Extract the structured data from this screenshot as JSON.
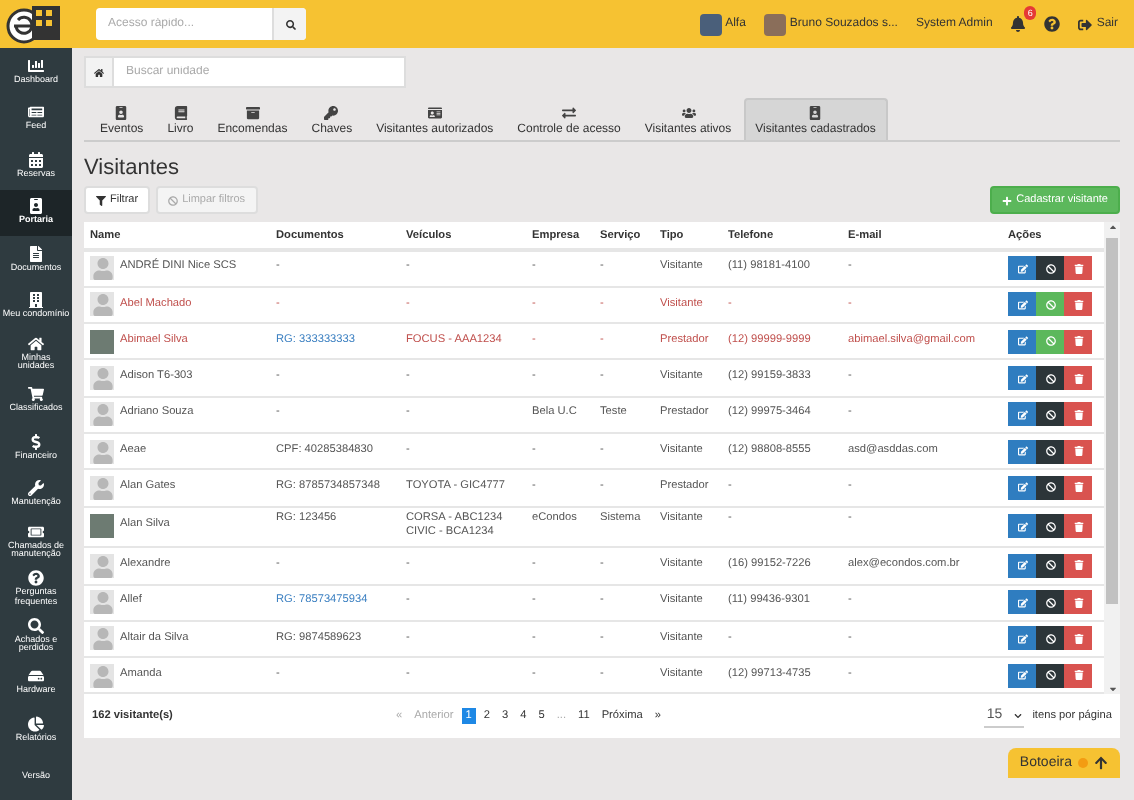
{
  "topbar": {
    "search": {
      "placeholder": "Acesso rápido..."
    },
    "condo": "Alfa",
    "user": "Bruno Souzados s...",
    "role": "System Admin",
    "notifications": "6",
    "logout": "Sair"
  },
  "sidebar": {
    "items": [
      {
        "label": "Dashboard",
        "selected": false
      },
      {
        "label": "Feed",
        "selected": false
      },
      {
        "label": "Reservas",
        "selected": false
      },
      {
        "label": "Portaria",
        "selected": true
      },
      {
        "label": "Documentos",
        "selected": false
      },
      {
        "label": "Meu condomínio",
        "selected": false
      },
      {
        "label": "Minhas unidades",
        "selected": false
      },
      {
        "label": "Classificados",
        "selected": false
      },
      {
        "label": "Financeiro",
        "selected": false
      },
      {
        "label": "Manutenção",
        "selected": false
      },
      {
        "label": "Chamados de manutenção",
        "selected": false
      },
      {
        "label": "Perguntas frequentes",
        "selected": false
      },
      {
        "label": "Achados e perdidos",
        "selected": false
      },
      {
        "label": "Hardware",
        "selected": false
      },
      {
        "label": "Relatórios",
        "selected": false
      },
      {
        "label": "Versão",
        "selected": false
      }
    ]
  },
  "unit_search": {
    "placeholder": "Buscar unidade"
  },
  "tabs": [
    {
      "label": "Eventos",
      "selected": false
    },
    {
      "label": "Livro",
      "selected": false
    },
    {
      "label": "Encomendas",
      "selected": false
    },
    {
      "label": "Chaves",
      "selected": false
    },
    {
      "label": "Visitantes autorizados",
      "selected": false
    },
    {
      "label": "Controle de acesso",
      "selected": false
    },
    {
      "label": "Visitantes ativos",
      "selected": false
    },
    {
      "label": "Visitantes cadastrados",
      "selected": true
    }
  ],
  "page": {
    "title": "Visitantes",
    "filter_button": "Filtrar",
    "clear_button": "Limpar filtros",
    "add_button": "Cadastrar visitante"
  },
  "table": {
    "columns": [
      "Name",
      "Documentos",
      "Veículos",
      "Empresa",
      "Serviço",
      "Tipo",
      "Telefone",
      "E-mail",
      "Ações"
    ],
    "rows": [
      {
        "has_photo": false,
        "name": "ANDRÉ DINI Nice SCS",
        "document": {
          "text": "-",
          "link": false
        },
        "vehicles": [
          "-"
        ],
        "company": "-",
        "service": "-",
        "type": "Visitante",
        "phone": "(11) 98181-4100",
        "email": "-",
        "blocked": false
      },
      {
        "has_photo": false,
        "name": "Abel Machado",
        "document": {
          "text": "-",
          "link": false
        },
        "vehicles": [
          "-"
        ],
        "company": "-",
        "service": "-",
        "type": "Visitante",
        "phone": "-",
        "email": "-",
        "blocked": true
      },
      {
        "has_photo": true,
        "name": "Abimael Silva",
        "document": {
          "text": "RG: 333333333",
          "link": true
        },
        "vehicles": [
          "FOCUS - AAA1234"
        ],
        "company": "-",
        "service": "-",
        "type": "Prestador",
        "phone": "(12) 99999-9999",
        "email": "abimael.silva@gmail.com",
        "blocked": true
      },
      {
        "has_photo": false,
        "name": "Adison T6-303",
        "document": {
          "text": "-",
          "link": false
        },
        "vehicles": [
          "-"
        ],
        "company": "-",
        "service": "-",
        "type": "Visitante",
        "phone": "(12) 99159-3833",
        "email": "-",
        "blocked": false
      },
      {
        "has_photo": false,
        "name": "Adriano Souza",
        "document": {
          "text": "-",
          "link": false
        },
        "vehicles": [
          "-"
        ],
        "company": "Bela U.C",
        "service": "Teste",
        "type": "Prestador",
        "phone": "(12) 99975-3464",
        "email": "-",
        "blocked": false
      },
      {
        "has_photo": false,
        "name": "Aeae",
        "document": {
          "text": "CPF: 40285384830",
          "link": false
        },
        "vehicles": [
          "-"
        ],
        "company": "-",
        "service": "-",
        "type": "Visitante",
        "phone": "(12) 98808-8555",
        "email": "asd@asddas.com",
        "blocked": false
      },
      {
        "has_photo": false,
        "name": "Alan Gates",
        "document": {
          "text": "RG: 8785734857348",
          "link": false
        },
        "vehicles": [
          "TOYOTA - GIC4777"
        ],
        "company": "-",
        "service": "-",
        "type": "Prestador",
        "phone": "-",
        "email": "-",
        "blocked": false
      },
      {
        "has_photo": true,
        "name": "Alan Silva",
        "document": {
          "text": "RG: 123456",
          "link": false
        },
        "vehicles": [
          "CORSA - ABC1234",
          "CIVIC - BCA1234"
        ],
        "company": "eCondos",
        "service": "Sistema",
        "type": "Visitante",
        "phone": "-",
        "email": "-",
        "blocked": false
      },
      {
        "has_photo": false,
        "name": "Alexandre",
        "document": {
          "text": "-",
          "link": false
        },
        "vehicles": [
          "-"
        ],
        "company": "-",
        "service": "-",
        "type": "Visitante",
        "phone": "(16) 99152-7226",
        "email": "alex@econdos.com.br",
        "blocked": false
      },
      {
        "has_photo": false,
        "name": "Allef",
        "document": {
          "text": "RG: 78573475934",
          "link": true
        },
        "vehicles": [
          "-"
        ],
        "company": "-",
        "service": "-",
        "type": "Visitante",
        "phone": "(11) 99436-9301",
        "email": "-",
        "blocked": false
      },
      {
        "has_photo": false,
        "name": "Altair da Silva",
        "document": {
          "text": "RG: 9874589623",
          "link": false
        },
        "vehicles": [
          "-"
        ],
        "company": "-",
        "service": "-",
        "type": "Visitante",
        "phone": "-",
        "email": "-",
        "blocked": false
      },
      {
        "has_photo": false,
        "name": "Amanda",
        "document": {
          "text": "-",
          "link": false
        },
        "vehicles": [
          "-"
        ],
        "company": "-",
        "service": "-",
        "type": "Visitante",
        "phone": "(12) 99713-4735",
        "email": "-",
        "blocked": false
      }
    ]
  },
  "footer": {
    "count": "162 visitante(s)",
    "pagination": [
      {
        "label": "«",
        "selected": false,
        "disabled": true
      },
      {
        "label": "Anterior",
        "selected": false,
        "disabled": true
      },
      {
        "label": "1",
        "selected": true,
        "disabled": false
      },
      {
        "label": "2",
        "selected": false,
        "disabled": false
      },
      {
        "label": "3",
        "selected": false,
        "disabled": false
      },
      {
        "label": "4",
        "selected": false,
        "disabled": false
      },
      {
        "label": "5",
        "selected": false,
        "disabled": false
      },
      {
        "label": "...",
        "selected": false,
        "disabled": true
      },
      {
        "label": "11",
        "selected": false,
        "disabled": false
      },
      {
        "label": "Próxima",
        "selected": false,
        "disabled": false
      },
      {
        "label": "»",
        "selected": false,
        "disabled": false
      }
    ],
    "page_size": "15",
    "page_size_label": "itens por página"
  },
  "floating_button": {
    "label": "Botoeira"
  }
}
